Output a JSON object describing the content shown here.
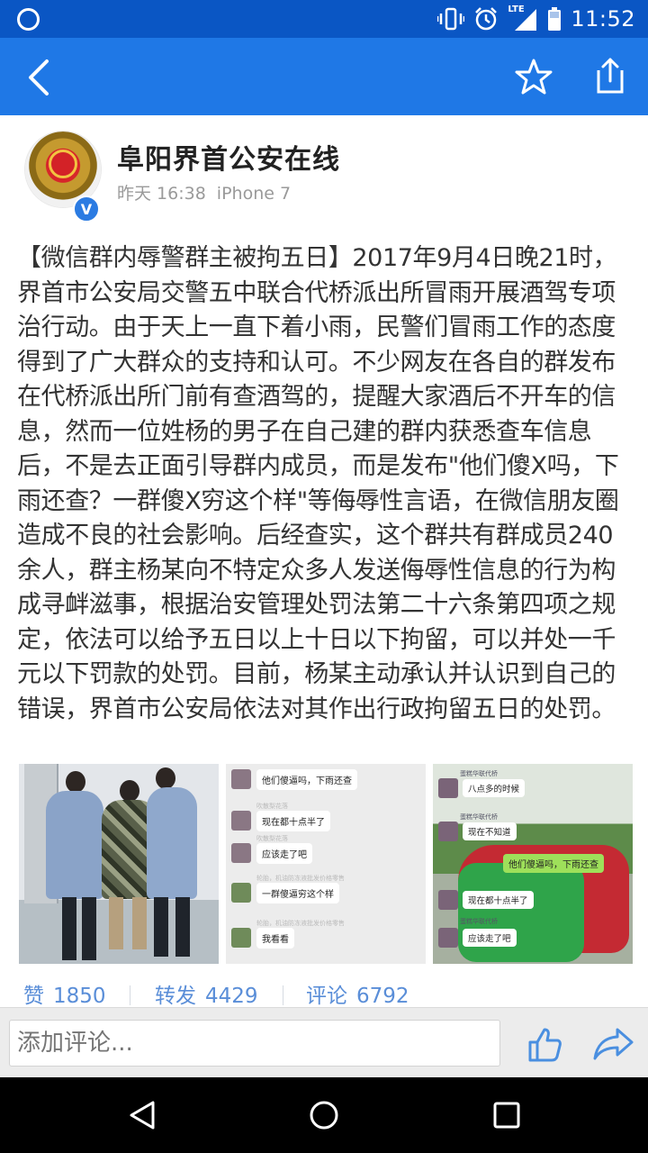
{
  "status_bar": {
    "time": "11:52",
    "network_label": "LTE",
    "icons": [
      "circle-notification-icon",
      "vibrate-icon",
      "alarm-icon",
      "signal-icon",
      "battery-icon"
    ]
  },
  "app_bar": {
    "icons": [
      "back-arrow-icon",
      "star-icon",
      "share-icon"
    ],
    "color": "#1f78e6"
  },
  "post": {
    "account_name": "阜阳界首公安在线",
    "verified_badge": "V",
    "time": "昨天 16:38",
    "source": "iPhone 7",
    "body": "【微信群内辱警群主被拘五日】2017年9月4日晚21时，界首市公安局交警五中联合代桥派出所冒雨开展酒驾专项治行动。由于天上一直下着小雨，民警们冒雨工作的态度得到了广大群众的支持和认可。不少网友在各自的群发布在代桥派出所门前有查酒驾的，提醒大家酒后不开车的信息，然而一位姓杨的男子在自己建的群内获悉查车信息后，不是去正面引导群内成员，而是发布\"他们傻X吗，下雨还查？一群傻X穷这个样\"等侮辱性言语，在微信朋友圈造成不良的社会影响。后经查实，这个群共有群成员240余人，群主杨某向不特定众多人发送侮辱性信息的行为构成寻衅滋事，根据治安管理处罚法第二十六条第四项之规定，依法可以给予五日以上十日以下拘留，可以并处一千元以下罚款的处罚。目前，杨某主动承认并认识到自己的错误，界首市公安局依法对其作出行政拘留五日的处罚。",
    "photo2_chat": [
      "他们傻逼吗，下雨还查",
      "现在都十点半了",
      "应该走了吧",
      "一群傻逼穷这个样",
      "我看看"
    ],
    "photo2_notes": [
      "吹散梨花落",
      "吹散梨花落",
      "吹散梨花落",
      "轮胎，机油防冻液批发价格零售",
      "轮胎，机油防冻液批发价格零售",
      "轮胎，机油防冻液批发价格零售"
    ],
    "photo3_chat": [
      "八点多的时候",
      "现在不知道",
      "现在都十点半了",
      "应该走了吧"
    ],
    "photo3_highlight": "他们傻逼吗，下雨还查",
    "photo3_names": [
      "蛋糕华联代桥",
      "蛋糕华联代桥",
      "蛋糕华联代桥"
    ]
  },
  "stats": {
    "likes_label": "赞",
    "likes": "1850",
    "reposts_label": "转发",
    "reposts": "4429",
    "comments_label": "评论",
    "comments": "6792"
  },
  "comment_bar": {
    "placeholder": "添加评论..."
  },
  "nav_bar": {
    "icons": [
      "nav-back-icon",
      "nav-home-icon",
      "nav-recents-icon"
    ]
  }
}
